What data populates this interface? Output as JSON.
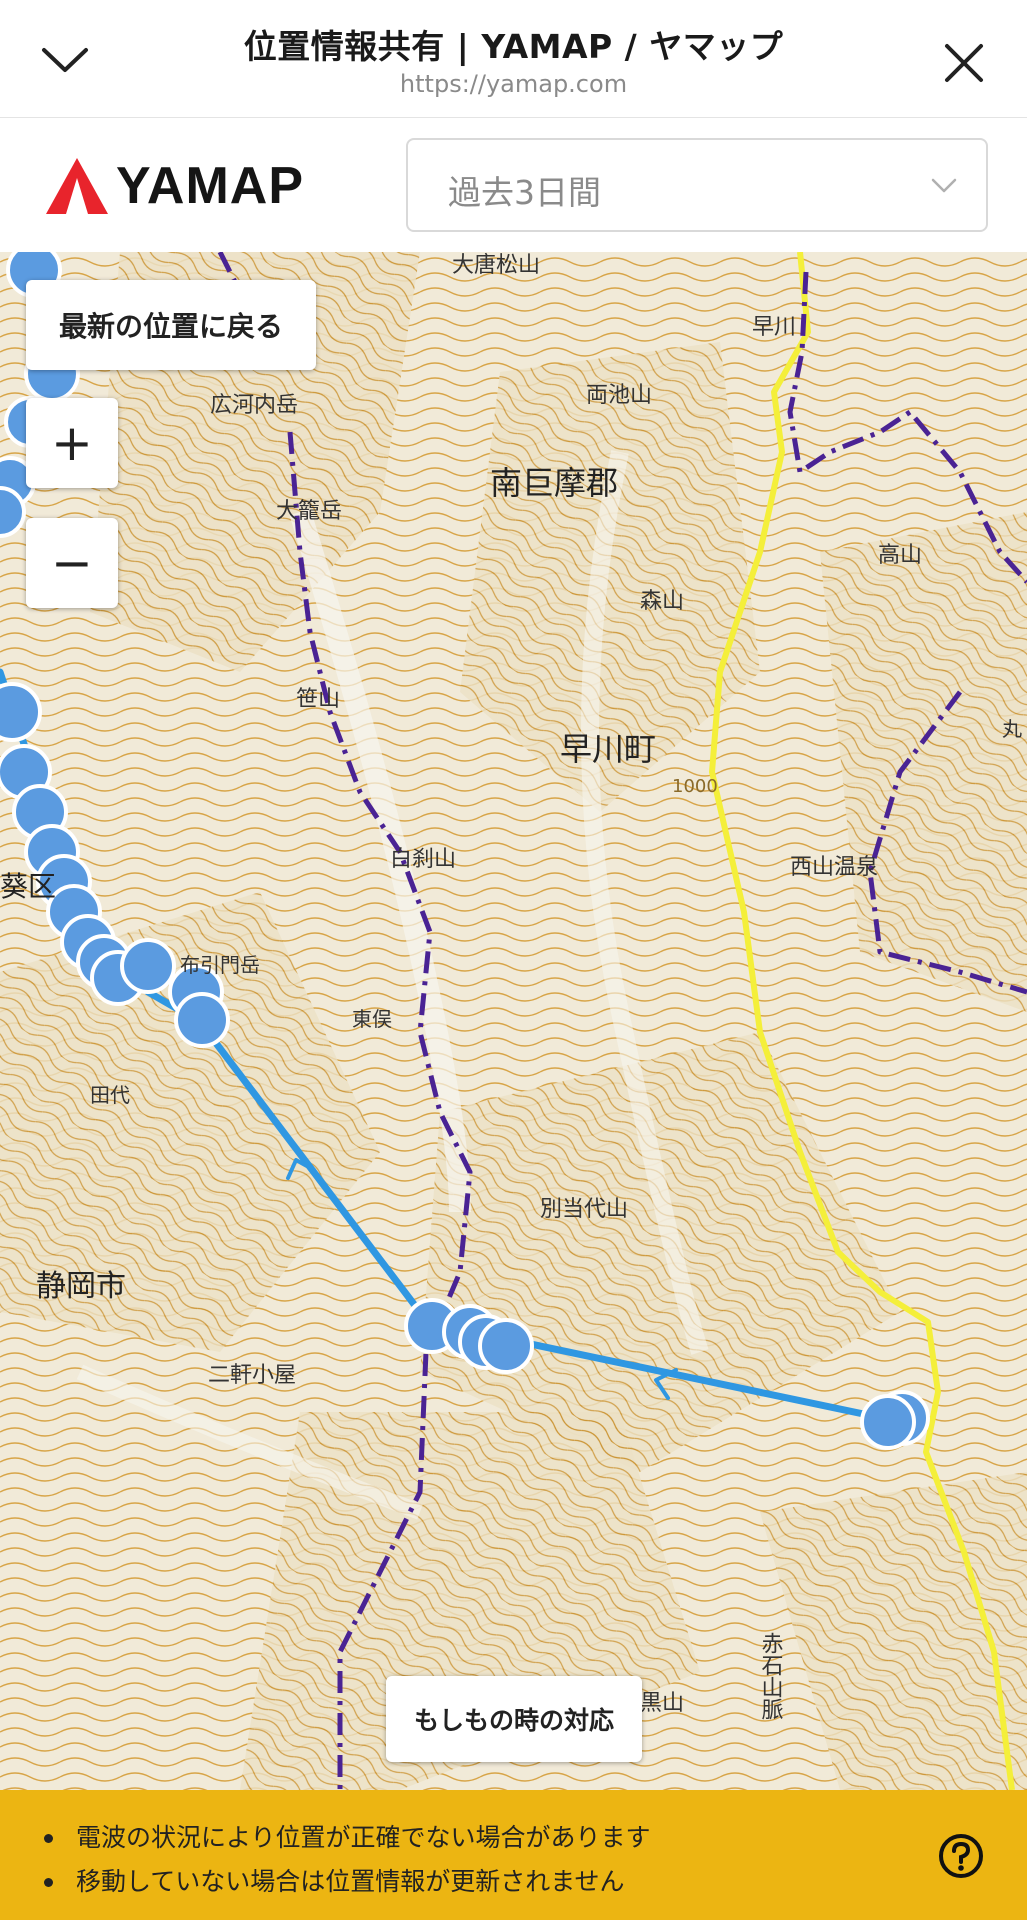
{
  "browser": {
    "title": "位置情報共有 | YAMAP / ヤマップ",
    "url": "https://yamap.com",
    "collapse_icon": "chevron-down-icon",
    "close_icon": "close-icon"
  },
  "header": {
    "logo_text": "YAMAP",
    "logo_icon": "yamap-logo-icon",
    "period_select": {
      "value": "過去3日間",
      "arrow_icon": "chevron-down-icon"
    }
  },
  "map": {
    "latest_button": "最新の位置に戻る",
    "zoom_in": "+",
    "zoom_out": "−",
    "emergency_button": "もしもの時の対応",
    "labels": {
      "daitomatsu": "大唐松山",
      "hayakawa_river": "早川",
      "ryoike": "両池山",
      "hirogochi": "広河内岳",
      "minamikoma": "南巨摩郡",
      "obami": "大籠岳",
      "takayama": "高山",
      "moriyama": "森山",
      "sasayama": "笹山",
      "hayakawacho": "早川町",
      "elev1000": "1000",
      "maru": "丸",
      "nishiyama": "西山温泉",
      "shirasaki": "白刹山",
      "aoi": "葵区",
      "nobumon": "布引門岳",
      "higashimata": "東俣",
      "tawa": "田代",
      "betto": "別当代山",
      "shizuoka": "静岡市",
      "nikenkoya": "二軒小屋",
      "akaishi": "赤石山脈",
      "kurosan": "黒山"
    },
    "colors": {
      "track": "#2f97e2",
      "point_fill": "#5b9be0",
      "trail": "#4a2394",
      "road": "#f4ef3a",
      "contour": "#d49a2c"
    }
  },
  "notice": {
    "items": [
      "電波の状況により位置が正確でない場合があります",
      "移動していない場合は位置情報が更新されません"
    ],
    "help_icon": "help-circle-icon"
  }
}
